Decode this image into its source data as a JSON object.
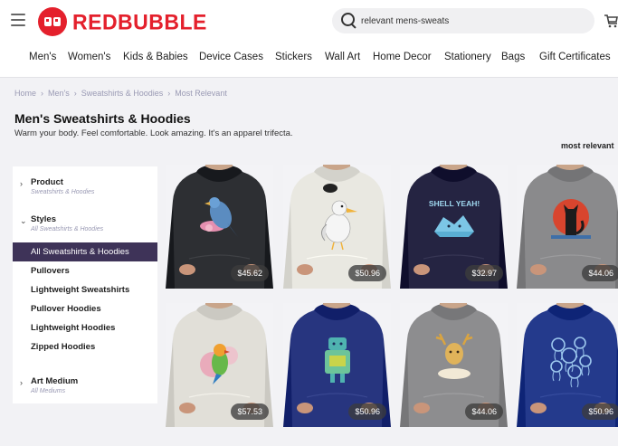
{
  "header": {
    "brand": "REDBUBBLE",
    "search_value": "relevant mens-sweats"
  },
  "nav": {
    "items": [
      "Men's",
      "Women's",
      "Kids & Babies",
      "Device Cases",
      "Stickers",
      "Wall Art",
      "Home Decor",
      "Stationery",
      "Bags",
      "Gift Certificates"
    ]
  },
  "breadcrumb": [
    "Home",
    "Men's",
    "Sweatshirts & Hoodies",
    "Most Relevant"
  ],
  "page": {
    "title": "Men's Sweatshirts & Hoodies",
    "subtitle": "Warm your body. Feel comfortable. Look amazing. It's an apparel trifecta.",
    "sort": "most relevant"
  },
  "filters": {
    "product": {
      "title": "Product",
      "sub": "Sweatshirts & Hoodies"
    },
    "styles": {
      "title": "Styles",
      "sub": "All Sweatshirts & Hoodies",
      "options": [
        "All Sweatshirts & Hoodies",
        "Pullovers",
        "Lightweight Sweatshirts",
        "Pullover Hoodies",
        "Lightweight Hoodies",
        "Zipped Hoodies"
      ]
    },
    "art_medium": {
      "title": "Art Medium",
      "sub": "All Mediums"
    }
  },
  "products": [
    {
      "price": "$45.62",
      "color": "#2d2f33",
      "design": "bird"
    },
    {
      "price": "$50.96",
      "color": "#e9e8e1",
      "design": "seagull"
    },
    {
      "price": "$32.97",
      "color": "#252442",
      "design": "shell-yeah",
      "design_text": "SHELL YEAH!"
    },
    {
      "price": "$44.06",
      "color": "#8a8a8c",
      "design": "cat-moon"
    },
    {
      "price": "$57.53",
      "color": "#e1dfd8",
      "design": "parrot"
    },
    {
      "price": "$50.96",
      "color": "#27357f",
      "design": "robot"
    },
    {
      "price": "$44.06",
      "color": "#8d8d8f",
      "design": "deer"
    },
    {
      "price": "$50.96",
      "color": "#243a8c",
      "design": "jellyfish"
    }
  ],
  "colors": {
    "brand": "#e4202c",
    "active_filter": "#3e3358",
    "muted": "#9a9ab4"
  }
}
